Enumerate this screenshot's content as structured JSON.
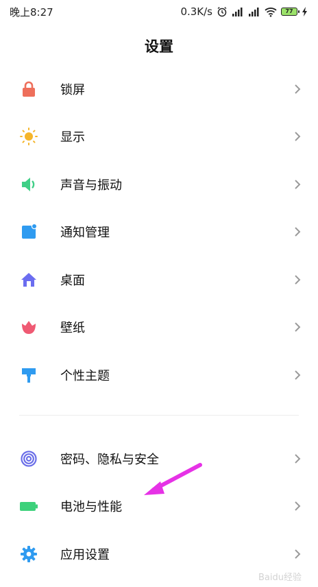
{
  "status_bar": {
    "time": "晚上8:27",
    "speed": "0.3K/s",
    "battery": "77"
  },
  "page_title": "设置",
  "items": [
    {
      "label": "锁屏",
      "icon": "lock-icon",
      "color": "#ee6f5b"
    },
    {
      "label": "显示",
      "icon": "sun-icon",
      "color": "#f5b52a"
    },
    {
      "label": "声音与振动",
      "icon": "speaker-icon",
      "color": "#3fcf86"
    },
    {
      "label": "通知管理",
      "icon": "notification-icon",
      "color": "#2f9bf0"
    },
    {
      "label": "桌面",
      "icon": "home-icon",
      "color": "#6b6df0"
    },
    {
      "label": "壁纸",
      "icon": "tulip-icon",
      "color": "#ef5a73"
    },
    {
      "label": "个性主题",
      "icon": "brush-icon",
      "color": "#2f9bf0"
    },
    {
      "label": "密码、隐私与安全",
      "icon": "fingerprint-icon",
      "color": "#6a6ee8"
    },
    {
      "label": "电池与性能",
      "icon": "battery-icon",
      "color": "#3dd17b"
    },
    {
      "label": "应用设置",
      "icon": "gear-icon",
      "color": "#2f9bf0"
    }
  ],
  "watermark": "Baidu经验"
}
